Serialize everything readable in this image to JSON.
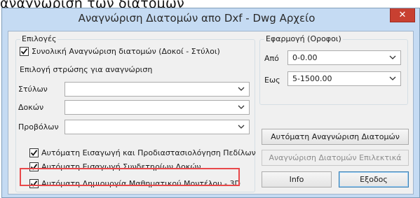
{
  "top_caption": "αναγνώριση των διατομών",
  "window": {
    "title": "Αναγνώριση Διατομών απο Dxf - Dwg Αρχείο",
    "close_glyph": "✕"
  },
  "options": {
    "group_title": "Επιλογές",
    "overall_recognition": {
      "label": "Συνολική Αναγνώριση διατομών (Δοκοί - Στύλοι)",
      "checked": true
    },
    "layer_heading": "Επιλογή στρώσης για αναγνώριση",
    "columns": {
      "label": "Στύλων",
      "value": ""
    },
    "beams": {
      "label": "Δοκών",
      "value": ""
    },
    "cantilevers": {
      "label": "Προβόλων",
      "value": ""
    },
    "auto_slab_insert": {
      "label": "Αυτόματη Εισαγωγή και Προδιαστασιολόγηση Πεδίλων",
      "checked": true
    },
    "auto_beam_connectors": {
      "label": "Αυτόματη Εισαγωγή Συνδετηρίων Δοκών",
      "checked": true
    },
    "auto_3d_model": {
      "label": "Αυτόματη Δημιουργία Μαθηματικού Μοντέλου - 3D",
      "checked": true
    }
  },
  "floors": {
    "group_title": "Εφαρμογή (Οροφοι)",
    "from": {
      "label": "Από",
      "value": "0-0.00"
    },
    "to": {
      "label": "Εως",
      "value": "5-1500.00"
    }
  },
  "buttons": {
    "auto_recognition": "Αυτόματη Αναγνώριση Διατομών",
    "selected_recognition": "Αναγνώριση Διατομών Επιλεκτικά",
    "info": "Info",
    "exit": "Εξοδος"
  },
  "highlight_color": "#e8484a"
}
